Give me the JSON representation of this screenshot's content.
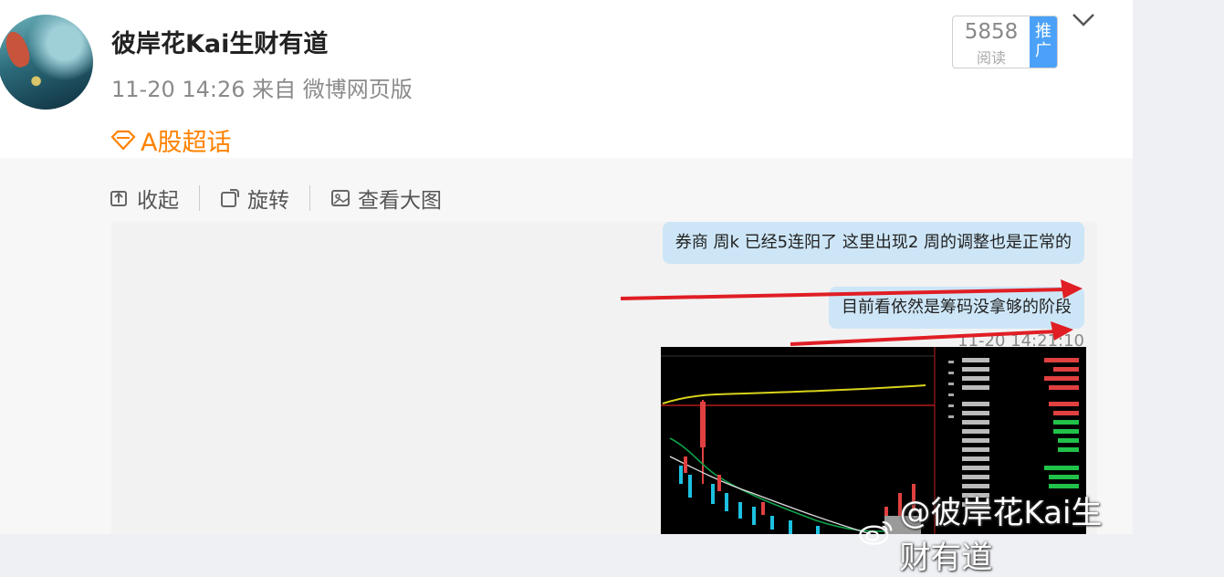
{
  "post": {
    "author": "彼岸花Kai生财有道",
    "time": "11-20 14:26",
    "source": "来自 微博网页版",
    "topic": "A股超话",
    "read_count": "5858",
    "read_label": "阅读",
    "promote_label": "推广"
  },
  "toolbar": {
    "collapse": "收起",
    "rotate": "旋转",
    "view_large": "查看大图"
  },
  "image": {
    "message1": "券商 周k  已经5连阳了 这里出现2 周的调整也是正常的",
    "message2": "目前看依然是筹码没拿够的阶段",
    "msg_time": "11-20 14:21:10"
  },
  "watermark": "@彼岸花Kai生财有道",
  "colors": {
    "accent": "#ff8200",
    "promo": "#4ba1f7",
    "bubble": "#cde6f7",
    "arrow": "#e01e24"
  }
}
